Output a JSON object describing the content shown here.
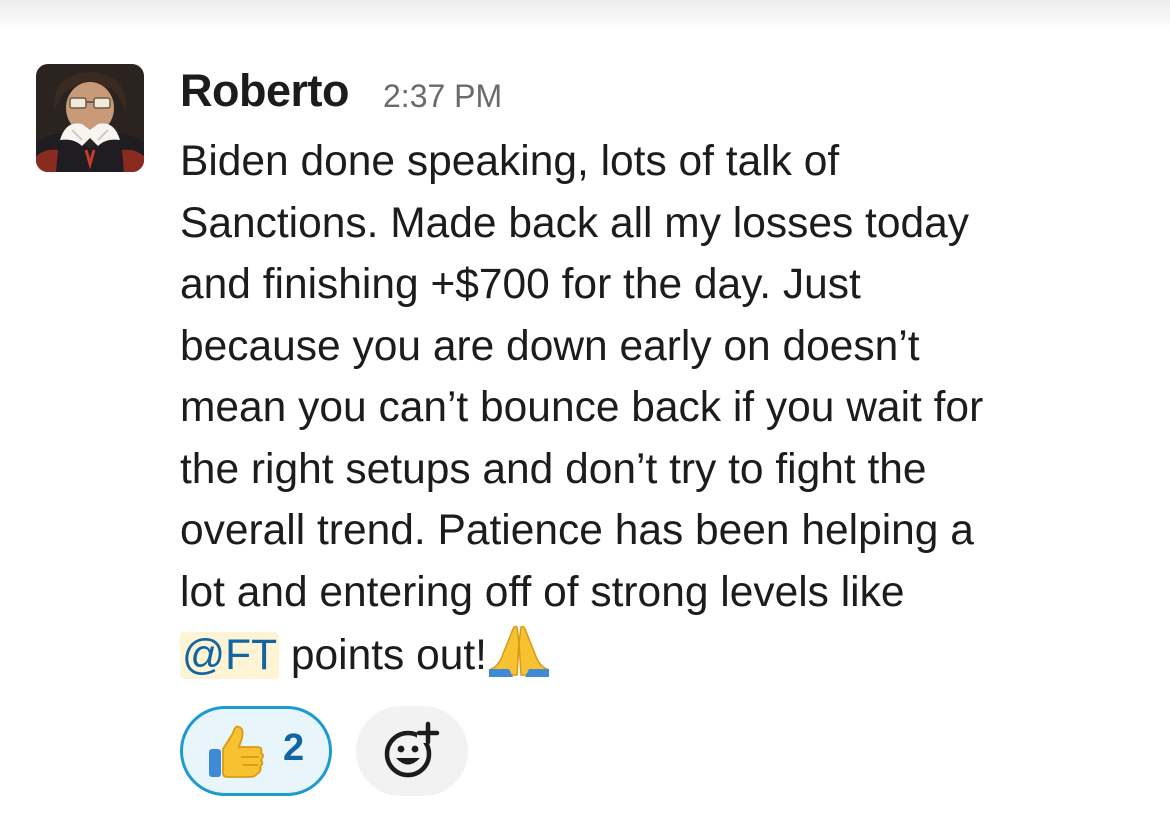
{
  "message": {
    "sender": "Roberto",
    "timestamp": "2:37 PM",
    "lines": [
      "Biden done speaking, lots of talk of",
      "Sanctions.  Made back all my losses today",
      "and finishing +$700 for the day.  Just",
      "because you are down early on doesn’t",
      "mean you can’t bounce back if you wait for",
      "the right setups and don’t try to fight the",
      "overall trend.  Patience has been helping a",
      "lot and entering off of strong levels like"
    ],
    "mention": "@FT",
    "last_line_text": " points out!",
    "inline_emoji": "folded-hands"
  },
  "reactions": [
    {
      "emoji": "thumbs-up",
      "count": "2",
      "selected": true
    }
  ],
  "add_reaction": {
    "icon": "add-reaction-icon"
  },
  "colors": {
    "text": "#1d1c1d",
    "timestamp": "#6b6a6b",
    "mention_bg": "#fdf3d5",
    "mention_text": "#1264a3",
    "reaction_border": "#1d9bd1",
    "reaction_bg": "#e8f5fa"
  }
}
